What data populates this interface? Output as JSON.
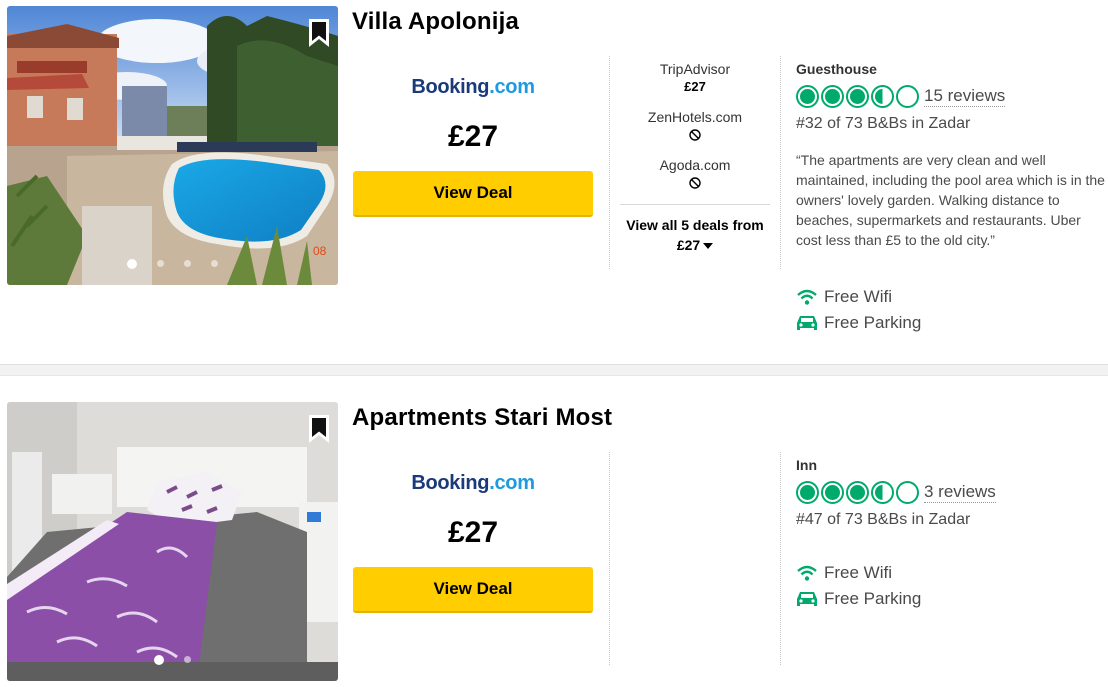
{
  "listings": [
    {
      "title": "Villa Apolonija",
      "provider": {
        "part1": "Booking",
        "part2": ".com"
      },
      "price": "£27",
      "deal_button": "View Deal",
      "photo_dots": 4,
      "photo_watermark": "08",
      "other_deals": [
        {
          "name": "TripAdvisor",
          "price": "£27",
          "available": true
        },
        {
          "name": "ZenHotels.com",
          "price": null,
          "available": false
        },
        {
          "name": "Agoda.com",
          "price": null,
          "available": false
        }
      ],
      "view_all": {
        "line1": "View all 5 deals from",
        "line2": "£27"
      },
      "property_type": "Guesthouse",
      "rating": 3.5,
      "reviews": "15 reviews",
      "rank": "#32 of 73 B&Bs in Zadar",
      "quote": "“The apartments are very clean and well maintained, including the pool area which is in the owners' lovely garden. Walking distance to beaches, supermarkets and restaurants. Uber cost less than £5 to the old city.”",
      "amenities": [
        {
          "label": "Free Wifi",
          "icon": "wifi-icon"
        },
        {
          "label": "Free Parking",
          "icon": "car-icon"
        }
      ]
    },
    {
      "title": "Apartments Stari Most",
      "provider": {
        "part1": "Booking",
        "part2": ".com"
      },
      "price": "£27",
      "deal_button": "View Deal",
      "photo_dots": 2,
      "property_type": "Inn",
      "rating": 3.5,
      "reviews": "3 reviews",
      "rank": "#47 of 73 B&Bs in Zadar",
      "amenities": [
        {
          "label": "Free Wifi",
          "icon": "wifi-icon"
        },
        {
          "label": "Free Parking",
          "icon": "car-icon"
        }
      ]
    }
  ],
  "colors": {
    "accent_green": "#00aa6c",
    "deal_yellow": "#ffcd00",
    "booking_dark": "#1a3a7a",
    "booking_light": "#1e9be0"
  }
}
